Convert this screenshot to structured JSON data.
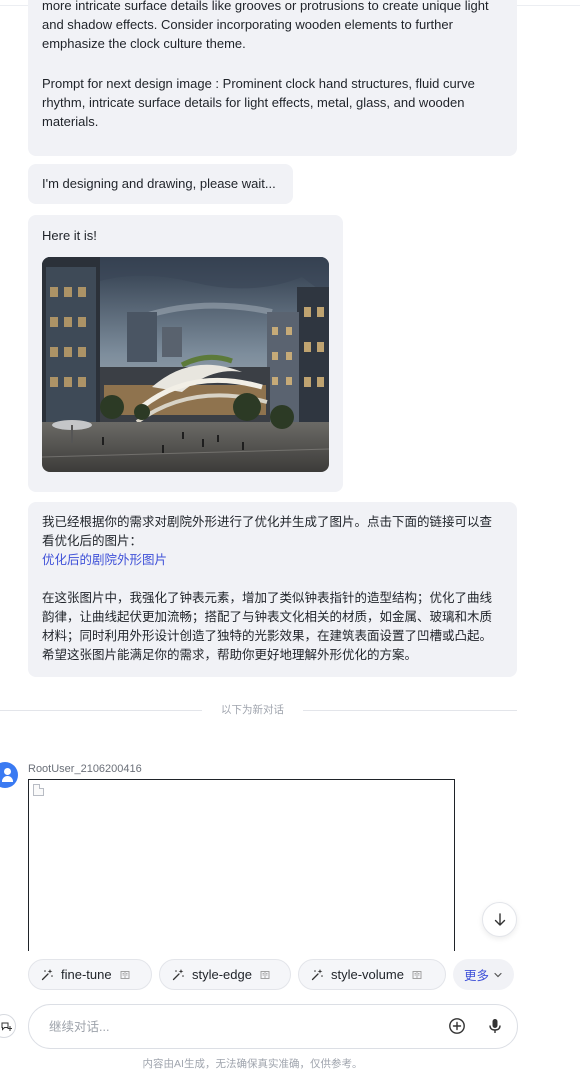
{
  "messages": {
    "design_prompt": {
      "line1": "more intricate surface details like grooves or protrusions to create unique light and shadow effects. Consider incorporating wooden elements to further emphasize the clock culture theme.",
      "line2": "Prompt for next design image : Prominent clock hand structures, fluid curve rhythm, intricate surface details for light effects, metal, glass, and wooden materials."
    },
    "status": "I'm designing and drawing, please wait...",
    "result_intro": "Here it is!",
    "summary": {
      "para1": "我已经根据你的需求对剧院外形进行了优化并生成了图片。点击下面的链接可以查看优化后的图片：",
      "link": "优化后的剧院外形图片",
      "para2": "在这张图片中，我强化了钟表元素，增加了类似钟表指针的造型结构；优化了曲线韵律，让曲线起伏更加流畅；搭配了与钟表文化相关的材质，如金属、玻璃和木质材料；同时利用外形设计创造了独特的光影效果，在建筑表面设置了凹槽或凸起。希望这张图片能满足你的需求，帮助你更好地理解外形优化的方案。"
    }
  },
  "divider_text": "以下为新对话",
  "user": {
    "name": "RootUser_2106200416"
  },
  "chips": [
    {
      "label": "fine-tune"
    },
    {
      "label": "style-edge"
    },
    {
      "label": "style-volume"
    }
  ],
  "more_label": "更多",
  "input": {
    "placeholder": "继续对话..."
  },
  "disclaimer": "内容由AI生成，无法确保真实准确，仅供参考。",
  "colors": {
    "accent": "#3f51d8",
    "bubble_bg": "#f1f2f6",
    "avatar": "#3a7af2"
  }
}
